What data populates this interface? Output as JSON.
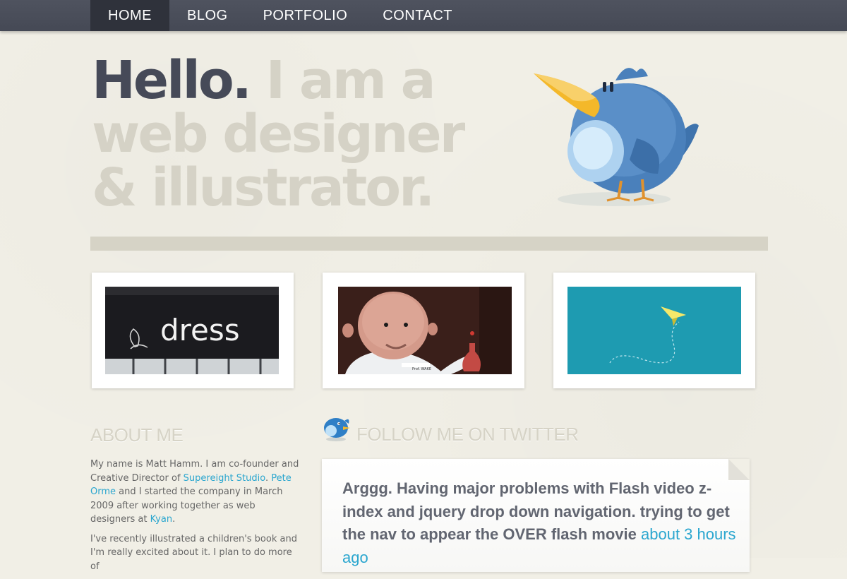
{
  "nav": {
    "items": [
      {
        "label": "HOME",
        "active": true
      },
      {
        "label": "BLOG",
        "active": false
      },
      {
        "label": "PORTFOLIO",
        "active": false
      },
      {
        "label": "CONTACT",
        "active": false
      }
    ]
  },
  "hero": {
    "hello": "Hello.",
    "line1_rest": "I am a",
    "line2": "web designer",
    "line3": "& illustrator."
  },
  "portfolio": {
    "thumb1_sign_text": "dress",
    "thumb2_label": "Prof. WAKE"
  },
  "about": {
    "title": "ABOUT ME",
    "p1_a": "My name is Matt Hamm. I am co-founder and Creative Director of ",
    "p1_link1": "Supereight Studio",
    "p1_b": ". ",
    "p1_link2": "Pete Orme",
    "p1_c": " and I started the company in March 2009 after working together as web designers at ",
    "p1_link3": "Kyan",
    "p1_d": ".",
    "p2": "I've recently illustrated a children's book and I'm really excited about it. I plan to do more of"
  },
  "twitter": {
    "title": "FOLLOW ME ON TWITTER",
    "tweet_text": "Arggg. Having major problems with Flash video z-index and jquery drop down navigation. trying to get the nav to appear the OVER flash movie ",
    "tweet_time": "about 3 hours ago"
  },
  "colors": {
    "nav_bg": "#4b4f5b",
    "nav_active": "#2f323b",
    "accent_link": "#2aa6cf",
    "hero_dark": "#464a58",
    "hero_light": "#d5d2c6",
    "paper": "#f1efe6"
  }
}
